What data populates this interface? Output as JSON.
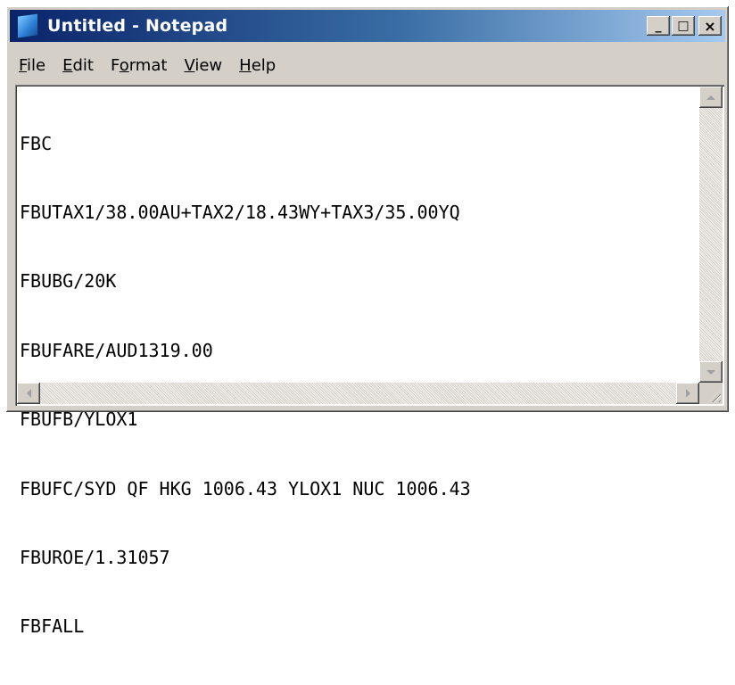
{
  "window": {
    "title": "Untitled - Notepad",
    "controls": {
      "minimize": "_",
      "maximize": "□",
      "close": "×"
    }
  },
  "menu": {
    "items": [
      {
        "label": "File",
        "underline": "F"
      },
      {
        "label": "Edit",
        "underline": "E"
      },
      {
        "label": "Format",
        "underline": "o"
      },
      {
        "label": "View",
        "underline": "V"
      },
      {
        "label": "Help",
        "underline": "H"
      }
    ]
  },
  "editor": {
    "lines": [
      "FBC",
      "FBUTAX1/38.00AU+TAX2/18.43WY+TAX3/35.00YQ",
      "FBUBG/20K",
      "FBUFARE/AUD1319.00",
      "FBUFB/YLOX1",
      "FBUFC/SYD QF HKG 1006.43 YLOX1 NUC 1006.43",
      "FBUROE/1.31057",
      "FBFALL"
    ]
  },
  "icons": {
    "app": "notepad-icon",
    "scroll_up": "arrow-up-icon",
    "scroll_down": "arrow-down-icon",
    "scroll_left": "arrow-left-icon",
    "scroll_right": "arrow-right-icon",
    "resize": "resize-grip-icon"
  }
}
